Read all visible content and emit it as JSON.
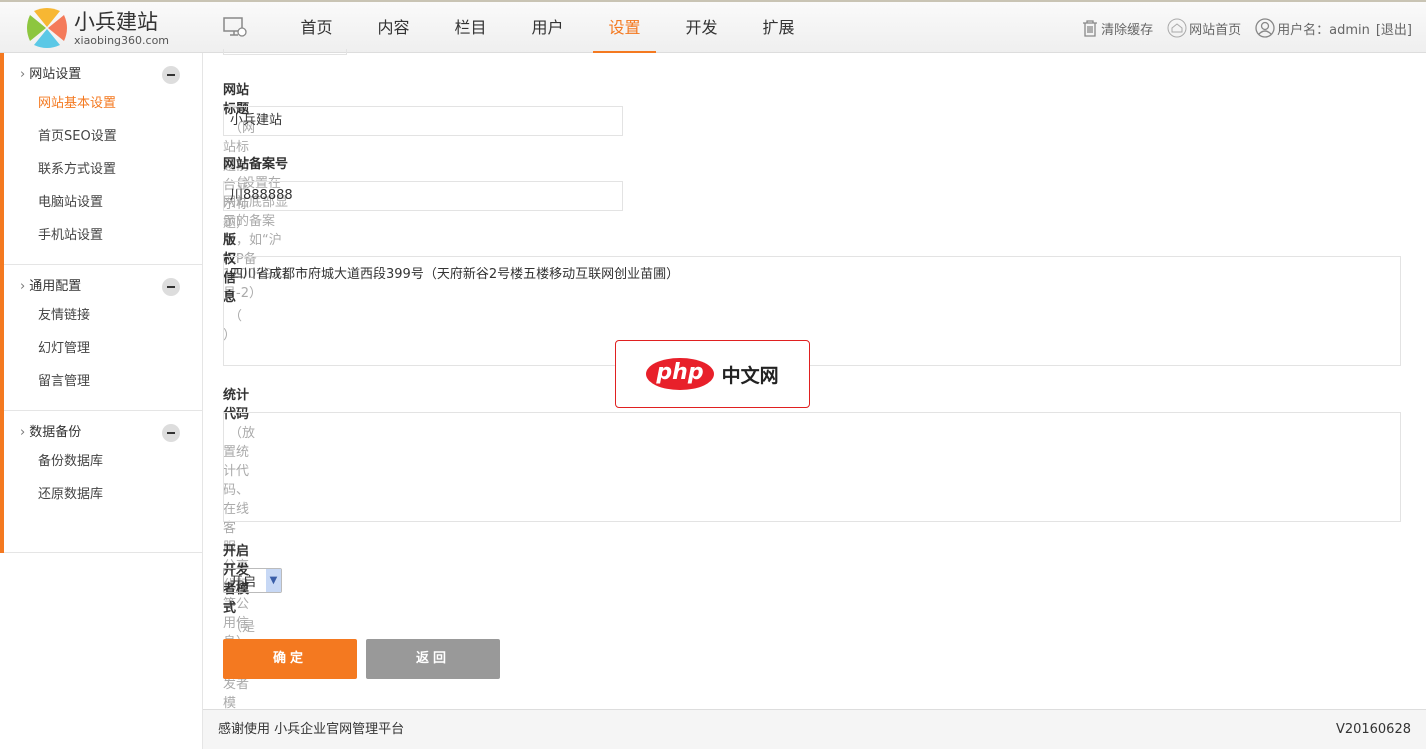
{
  "header": {
    "logo_name": "小兵建站",
    "logo_url": "xiaobing360.com",
    "nav": [
      "首页",
      "内容",
      "栏目",
      "用户",
      "设置",
      "开发",
      "扩展"
    ],
    "active_nav": "设置",
    "clear_cache": "清除缓存",
    "site_home": "网站首页",
    "user_label": "用户名：admin",
    "logout": "[退出]"
  },
  "sidebar": {
    "groups": [
      {
        "title": "网站设置",
        "items": [
          "网站基本设置",
          "首页SEO设置",
          "联系方式设置",
          "电脑站设置",
          "手机站设置"
        ]
      },
      {
        "title": "通用配置",
        "items": [
          "友情链接",
          "幻灯管理",
          "留言管理"
        ]
      },
      {
        "title": "数据备份",
        "items": [
          "备份数据库",
          "还原数据库"
        ]
      }
    ]
  },
  "form": {
    "title": {
      "label": "网站标题",
      "hint": "（网站标题前台显示标题）",
      "value": "小兵建站"
    },
    "icp": {
      "label": "网站备案号",
      "hint": "（设置在网站底部显示的备案号，如“沪ICP备12007941号-2）",
      "value": "川888888"
    },
    "copyright": {
      "label": "版权信息",
      "hint": "（ ）",
      "value": "四川省成都市府城大道西段399号（天府新谷2号楼五楼移动互联网创业苗圃）"
    },
    "stats": {
      "label": "统计代码",
      "hint": "（放置统计代码、在线客服、分享代码等公用信息）",
      "value": ""
    },
    "dev": {
      "label": "开启开发者模式",
      "hint": "（是否开启开发者模式）",
      "value": "开启"
    },
    "confirm": "确定",
    "back": "返回"
  },
  "footer": {
    "left": "感谢使用 小兵企业官网管理平台",
    "version": "V20160628"
  },
  "watermark": {
    "php": "php",
    "cn": "中文网"
  },
  "colors": {
    "accent": "#f47920",
    "back_button": "#999999"
  }
}
